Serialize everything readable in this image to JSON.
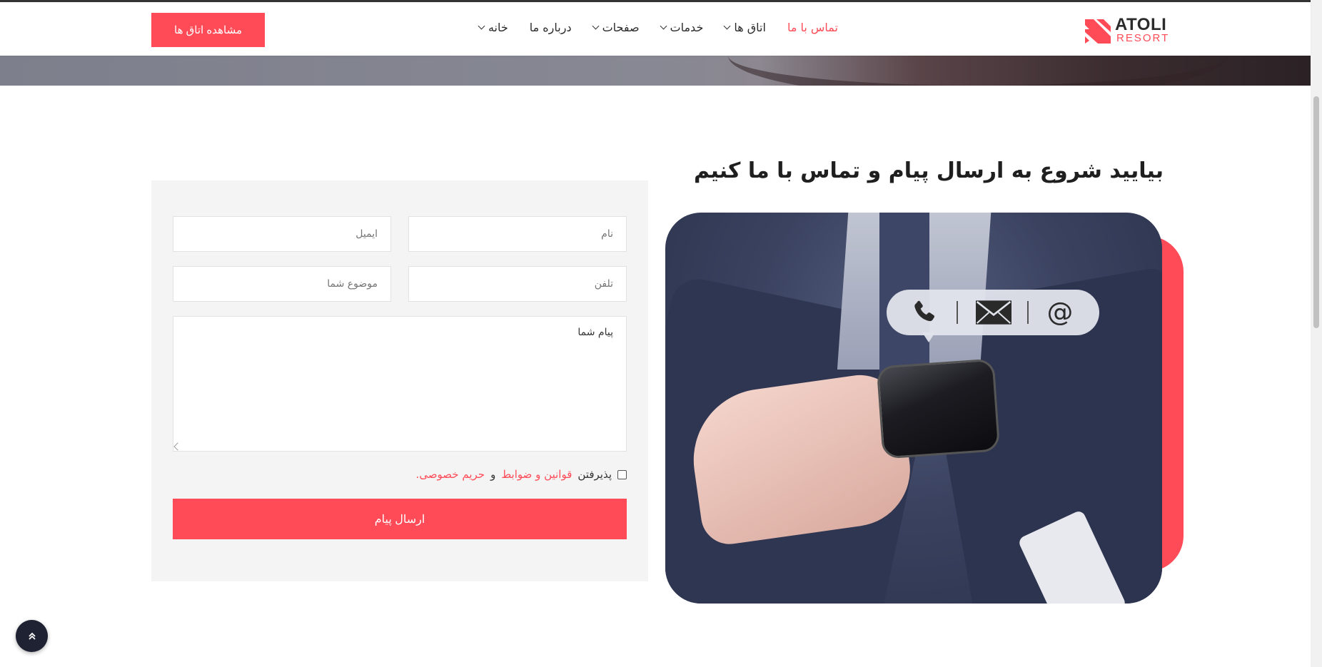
{
  "brand": {
    "title": "ATOLI",
    "subtitle": "RESORT",
    "accent_color": "#ff4b57"
  },
  "nav": {
    "items": [
      {
        "label": "خانه",
        "has_dropdown": true,
        "active": false
      },
      {
        "label": "درباره ما",
        "has_dropdown": false,
        "active": false
      },
      {
        "label": "صفحات",
        "has_dropdown": true,
        "active": false
      },
      {
        "label": "خدمات",
        "has_dropdown": true,
        "active": false
      },
      {
        "label": "اتاق ها",
        "has_dropdown": true,
        "active": false
      },
      {
        "label": "تماس با ما",
        "has_dropdown": false,
        "active": true
      }
    ],
    "cta_label": "مشاهده اتاق ها"
  },
  "section": {
    "title": "بیایید شروع به ارسال پیام و تماس با ما کنیم"
  },
  "form": {
    "name_placeholder": "نام",
    "email_placeholder": "ایمیل",
    "phone_placeholder": "تلفن",
    "subject_placeholder": "موضوع شما",
    "message_placeholder": "پیام شما",
    "agree_prefix": "پذیرفتن",
    "terms_link": "قوانین و ضوابط",
    "and_text": "و",
    "privacy_link": "حریم خصوصی.",
    "submit_label": "ارسال پیام"
  },
  "image": {
    "bubble_icons": [
      "phone-icon",
      "envelope-icon",
      "at-sign-icon"
    ]
  },
  "back_to_top": {
    "icon": "double-chevron-up-icon"
  }
}
